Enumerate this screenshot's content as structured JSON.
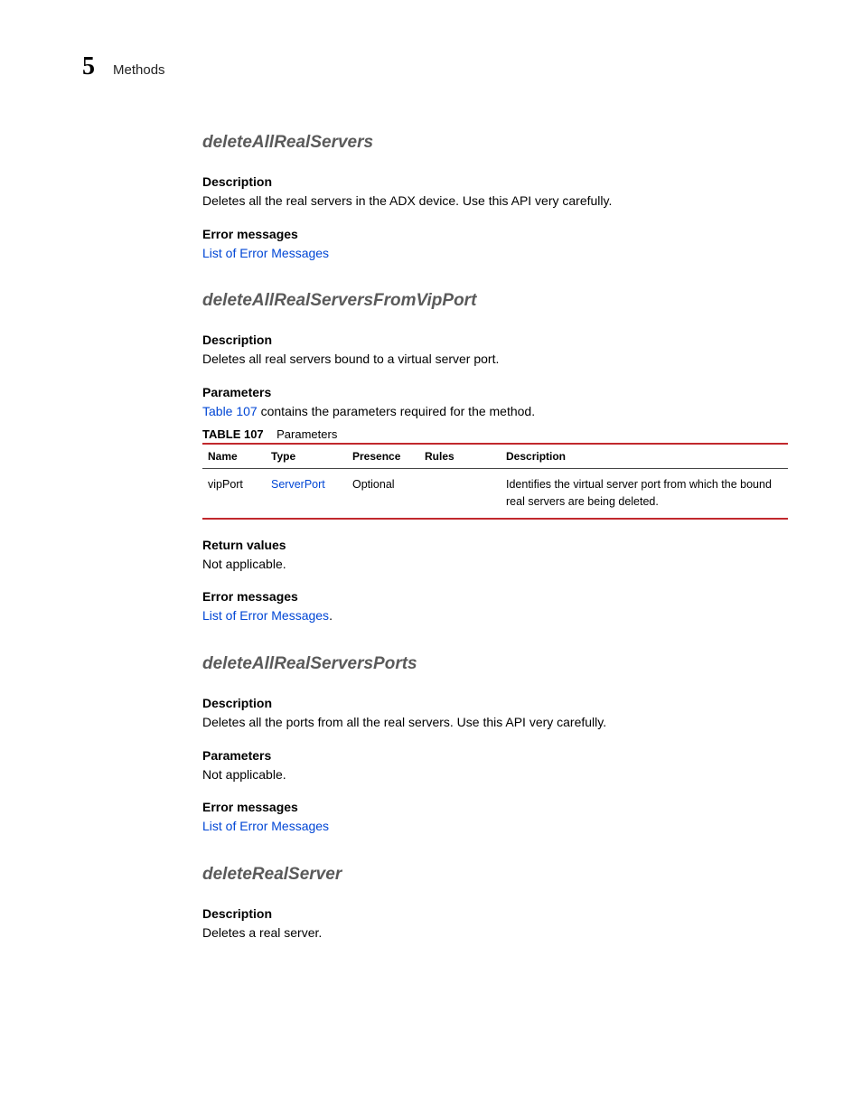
{
  "header": {
    "chapter_number": "5",
    "title": "Methods"
  },
  "methods": {
    "deleteAllRealServers": {
      "title": "deleteAllRealServers",
      "description_label": "Description",
      "description_text": "Deletes all the real servers in the ADX device. Use this API very carefully.",
      "error_label": "Error messages",
      "error_link": "List of Error Messages"
    },
    "deleteAllRealServersFromVipPort": {
      "title": "deleteAllRealServersFromVipPort",
      "description_label": "Description",
      "description_text": "Deletes all real servers bound to a virtual server port.",
      "parameters_label": "Parameters",
      "parameters_intro_link": "Table 107",
      "parameters_intro_text": " contains the parameters required for the method.",
      "table": {
        "caption_label": "TABLE 107",
        "caption_text": "Parameters",
        "headers": {
          "name": "Name",
          "type": "Type",
          "presence": "Presence",
          "rules": "Rules",
          "description": "Description"
        },
        "row": {
          "name": "vipPort",
          "type": "ServerPort",
          "presence": "Optional",
          "rules": "",
          "description": "Identifies the virtual server port from which the bound real servers are being deleted."
        }
      },
      "return_label": "Return values",
      "return_text": "Not applicable.",
      "error_label": "Error messages",
      "error_link": "List of Error Messages",
      "error_suffix": "."
    },
    "deleteAllRealServersPorts": {
      "title": "deleteAllRealServersPorts",
      "description_label": "Description",
      "description_text": "Deletes all the ports from all the real servers. Use this API very carefully.",
      "parameters_label": "Parameters",
      "parameters_text": "Not applicable.",
      "error_label": "Error messages",
      "error_link": "List of Error Messages"
    },
    "deleteRealServer": {
      "title": "deleteRealServer",
      "description_label": "Description",
      "description_text": "Deletes a real server."
    }
  }
}
